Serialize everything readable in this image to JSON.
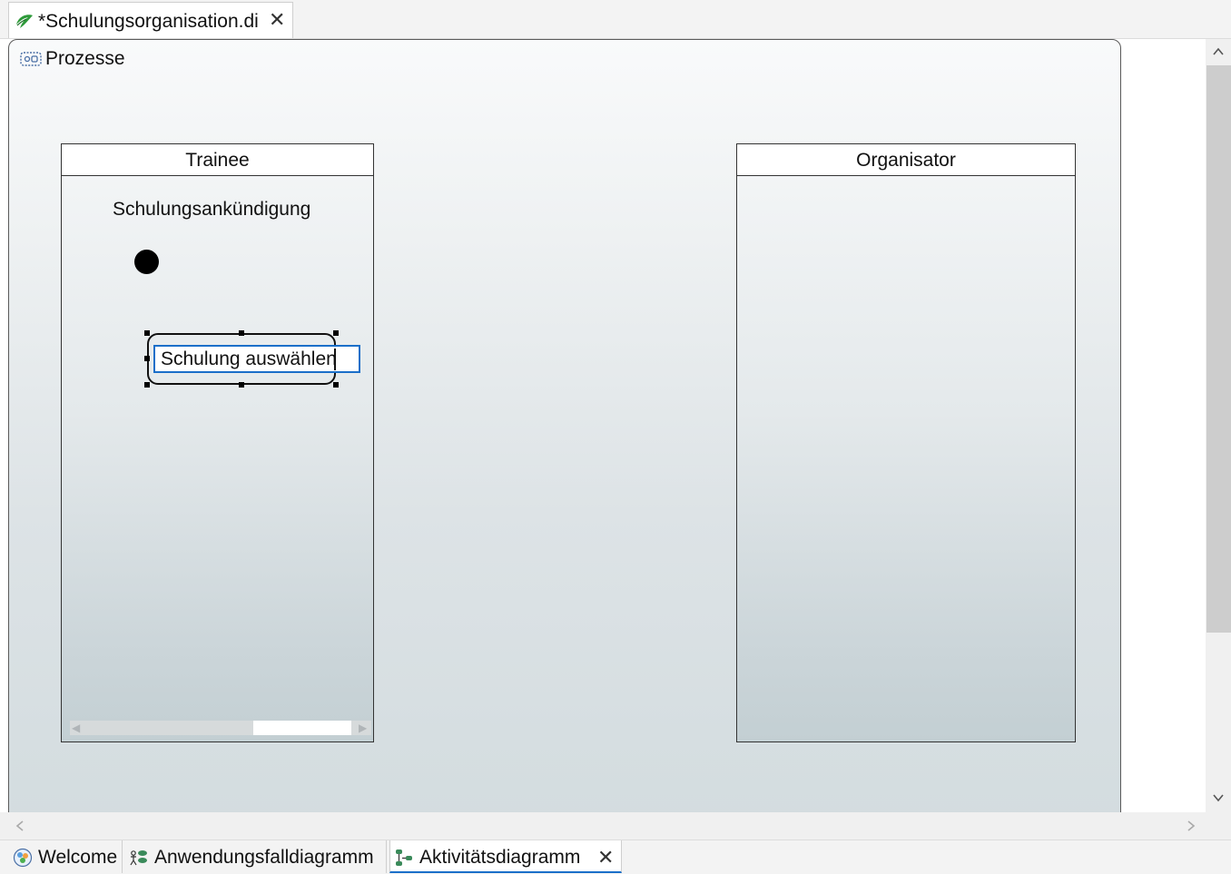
{
  "editor_tab": {
    "title": "*Schulungsorganisation.di",
    "close": "✕",
    "icon": "papyrus-leaf-icon"
  },
  "frame": {
    "title": "Prozesse",
    "icon": "activity-frame-icon"
  },
  "partitions": [
    {
      "name": "Trainee"
    },
    {
      "name": "Organisator"
    }
  ],
  "nodes": {
    "label": "Schulungsankündigung",
    "action_edit_text": "Schulung auswählen"
  },
  "scroll": {
    "up": "^",
    "down": "v",
    "left": "<",
    "right": ">"
  },
  "page_tabs": [
    {
      "label": "Welcome",
      "icon": "welcome-icon"
    },
    {
      "label": "Anwendungsfalldiagramm",
      "icon": "usecase-diagram-icon"
    },
    {
      "label": "Aktivitätsdiagramm",
      "icon": "activity-diagram-icon",
      "close": "✕",
      "active": true
    }
  ]
}
